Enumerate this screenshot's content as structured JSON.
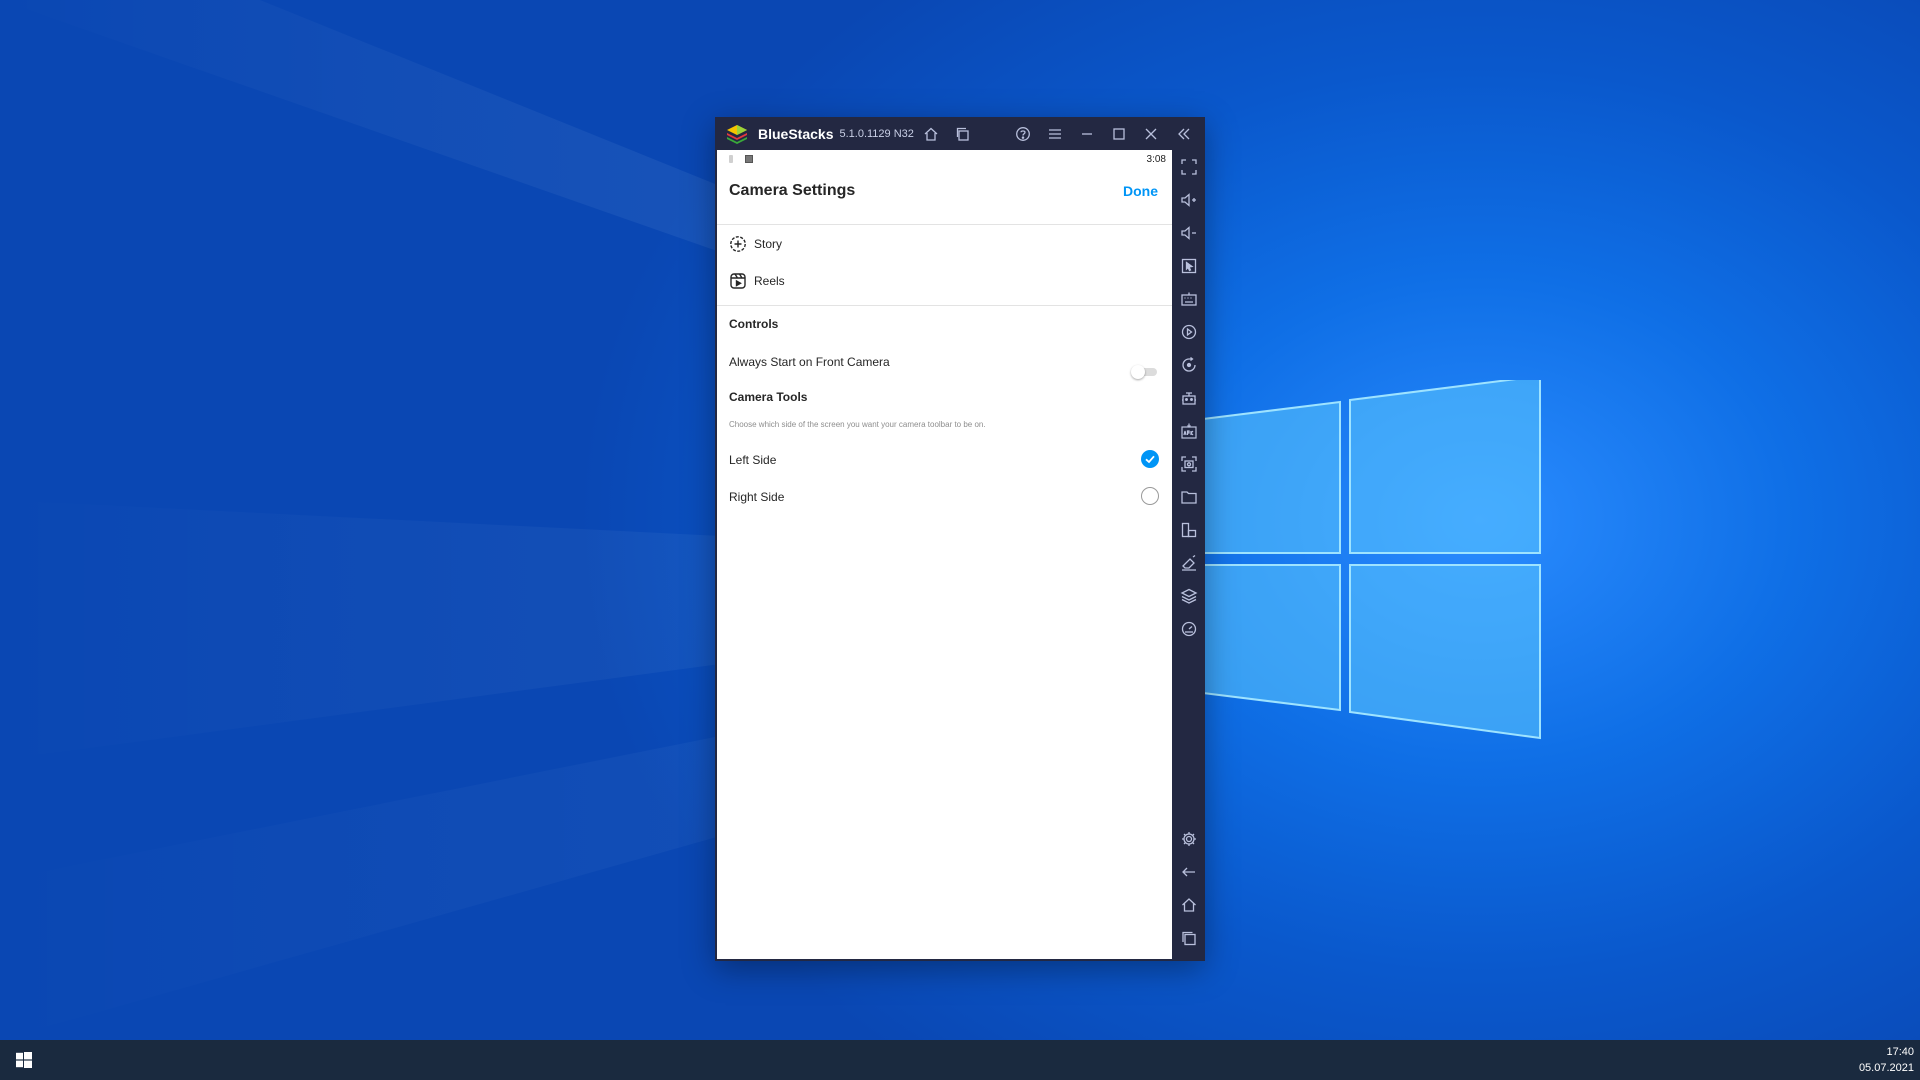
{
  "window": {
    "title": "BlueStacks",
    "version": "5.1.0.1129",
    "arch": "N32"
  },
  "android": {
    "status_time": "3:08",
    "header": {
      "title": "Camera Settings",
      "done_label": "Done"
    },
    "menu": [
      {
        "label": "Story",
        "icon": "story-plus-icon"
      },
      {
        "label": "Reels",
        "icon": "reels-icon"
      }
    ],
    "controls": {
      "title": "Controls",
      "front_camera_label": "Always Start on Front Camera",
      "front_camera_on": false
    },
    "camera_tools": {
      "title": "Camera Tools",
      "description": "Choose which side of the screen you want your camera toolbar to be on.",
      "options": [
        {
          "label": "Left Side",
          "selected": true
        },
        {
          "label": "Right Side",
          "selected": false
        }
      ]
    }
  },
  "taskbar": {
    "time": "17:40",
    "date": "05.07.2021"
  },
  "colors": {
    "accent": "#0095f6",
    "window_frame": "#232842",
    "taskbar": "#1a2a3f"
  }
}
